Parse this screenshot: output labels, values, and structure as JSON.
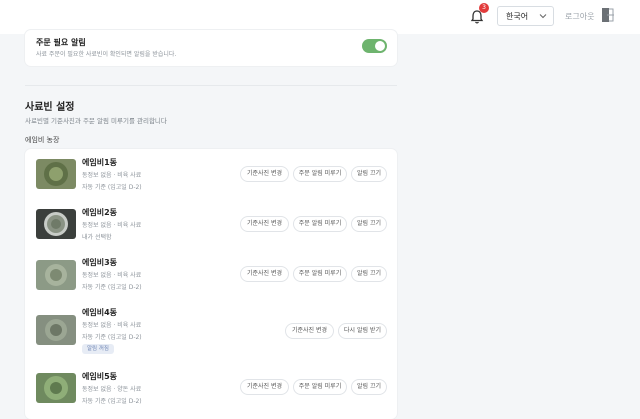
{
  "header": {
    "notification_count": "3",
    "language": "한국어",
    "logout_label": "로그아웃"
  },
  "alert_setting": {
    "title": "주문 필요 알림",
    "description": "사료 주문이 필요한 사료빈이 확인되면 알림을 받습니다.",
    "enabled": true
  },
  "bin_settings": {
    "title": "사료빈 설정",
    "description": "사료빈별 기준사진과 주문 알림 미루기를 관리합니다",
    "farm_name": "에임비 농장",
    "bins": [
      {
        "name": "에임비1동",
        "meta1": "동정보 없음 · 비육 사료",
        "meta2": "자동 기준 (입고일 D-2)",
        "tag": "",
        "buttons": [
          "기준사진 변경",
          "주문 알림 미루기",
          "알림 끄기"
        ]
      },
      {
        "name": "에임비2동",
        "meta1": "동정보 없음 · 비육 사료",
        "meta2": "내가 선택함",
        "tag": "",
        "buttons": [
          "기준사진 변경",
          "주문 알림 미루기",
          "알림 끄기"
        ]
      },
      {
        "name": "에임비3동",
        "meta1": "동정보 없음 · 비육 사료",
        "meta2": "자동 기준 (입고일 D-2)",
        "tag": "",
        "buttons": [
          "기준사진 변경",
          "주문 알림 미루기",
          "알림 끄기"
        ]
      },
      {
        "name": "에임비4동",
        "meta1": "동정보 없음 · 비육 사료",
        "meta2": "자동 기준 (입고일 D-2)",
        "tag": "알림 꺼짐",
        "buttons": [
          "기준사진 변경",
          "다시 알림 받기"
        ]
      },
      {
        "name": "에임비5동",
        "meta1": "동정보 없음 · 양돈 사료",
        "meta2": "자동 기준 (입고일 D-2)",
        "tag": "",
        "buttons": [
          "기준사진 변경",
          "주문 알림 미루기",
          "알림 끄기"
        ]
      }
    ]
  },
  "colors": {
    "toggle_on": "#6eb46e",
    "badge": "#e23b3b",
    "tag_bg": "#e7ecf5"
  }
}
